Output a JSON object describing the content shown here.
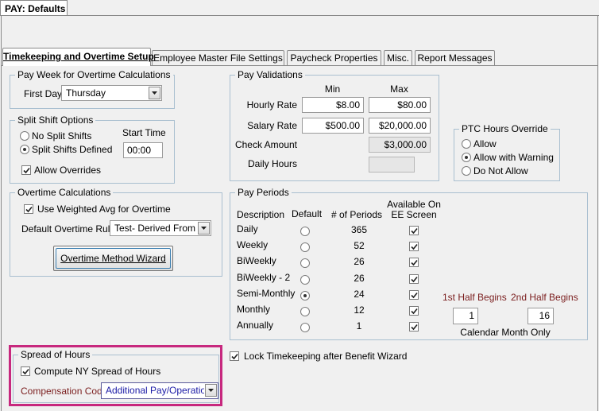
{
  "window": {
    "title": "PAY: Defaults"
  },
  "tabs": [
    {
      "label": "Timekeeping and Overtime Setup",
      "active": true
    },
    {
      "label": "Employee Master File Settings",
      "active": false
    },
    {
      "label": "Paycheck Properties",
      "active": false
    },
    {
      "label": "Misc.",
      "active": false
    },
    {
      "label": "Report Messages",
      "active": false
    }
  ],
  "pay_week": {
    "title": "Pay Week for Overtime Calculations",
    "first_day_label": "First Day",
    "first_day_value": "Thursday"
  },
  "split_shift": {
    "title": "Split Shift Options",
    "start_time_label": "Start Time",
    "start_time_value": "00:00",
    "options": [
      {
        "label": "No Split Shifts",
        "selected": false
      },
      {
        "label": "Split Shifts Defined",
        "selected": true
      }
    ],
    "allow_overrides_label": "Allow Overrides",
    "allow_overrides_checked": true
  },
  "overtime": {
    "title": "Overtime Calculations",
    "weighted_avg_label": "Use Weighted Avg for Overtime",
    "weighted_avg_checked": true,
    "rule_label": "Default Overtime Rule",
    "rule_value": "Test- Derived From I",
    "wizard_button": "Overtime Method Wizard"
  },
  "spread_of_hours": {
    "title": "Spread of Hours",
    "compute_label": "Compute NY Spread of Hours",
    "compute_checked": true,
    "comp_code_label": "Compensation Code",
    "comp_code_value": "Additional Pay/Operation",
    "highlight_color": "#c7287e"
  },
  "lock_timekeeping": {
    "label": "Lock Timekeeping after Benefit Wizard",
    "checked": true
  },
  "pay_validations": {
    "title": "Pay Validations",
    "min_header": "Min",
    "max_header": "Max",
    "hourly_rate": {
      "label": "Hourly Rate",
      "min": "$8.00",
      "max": "$80.00"
    },
    "salary_rate": {
      "label": "Salary Rate",
      "min": "$500.00",
      "max": "$20,000.00"
    },
    "check_amount": {
      "label": "Check Amount",
      "max": "$3,000.00"
    },
    "daily_hours": {
      "label": "Daily Hours",
      "max": ""
    }
  },
  "ptc_override": {
    "title": "PTC Hours Override",
    "options": [
      {
        "label": "Allow",
        "selected": false
      },
      {
        "label": "Allow with Warning",
        "selected": true
      },
      {
        "label": "Do Not Allow",
        "selected": false
      }
    ]
  },
  "pay_periods": {
    "title": "Pay Periods",
    "headers": {
      "description": "Description",
      "default": "Default",
      "periods": "# of Periods",
      "available_l1": "Available On",
      "available_l2": "EE Screen"
    },
    "rows": [
      {
        "description": "Daily",
        "default": false,
        "periods": "365",
        "available": true
      },
      {
        "description": "Weekly",
        "default": false,
        "periods": "52",
        "available": true
      },
      {
        "description": "BiWeekly",
        "default": false,
        "periods": "26",
        "available": true
      },
      {
        "description": "BiWeekly - 2",
        "default": false,
        "periods": "26",
        "available": true
      },
      {
        "description": "Semi-Monthly",
        "default": true,
        "periods": "24",
        "available": true
      },
      {
        "description": "Monthly",
        "default": false,
        "periods": "12",
        "available": true
      },
      {
        "description": "Annually",
        "default": false,
        "periods": "1",
        "available": true
      }
    ],
    "first_half_label": "1st Half Begins",
    "first_half_value": "1",
    "second_half_label": "2nd Half Begins",
    "second_half_value": "16",
    "calendar_note": "Calendar Month Only"
  },
  "colors": {
    "accent_red": "#7a1d1d",
    "link_blue": "#1a1aa6",
    "group_border": "#a9bfd0"
  },
  "icons": {
    "check": "check-icon",
    "dropdown": "chevron-down-icon"
  }
}
